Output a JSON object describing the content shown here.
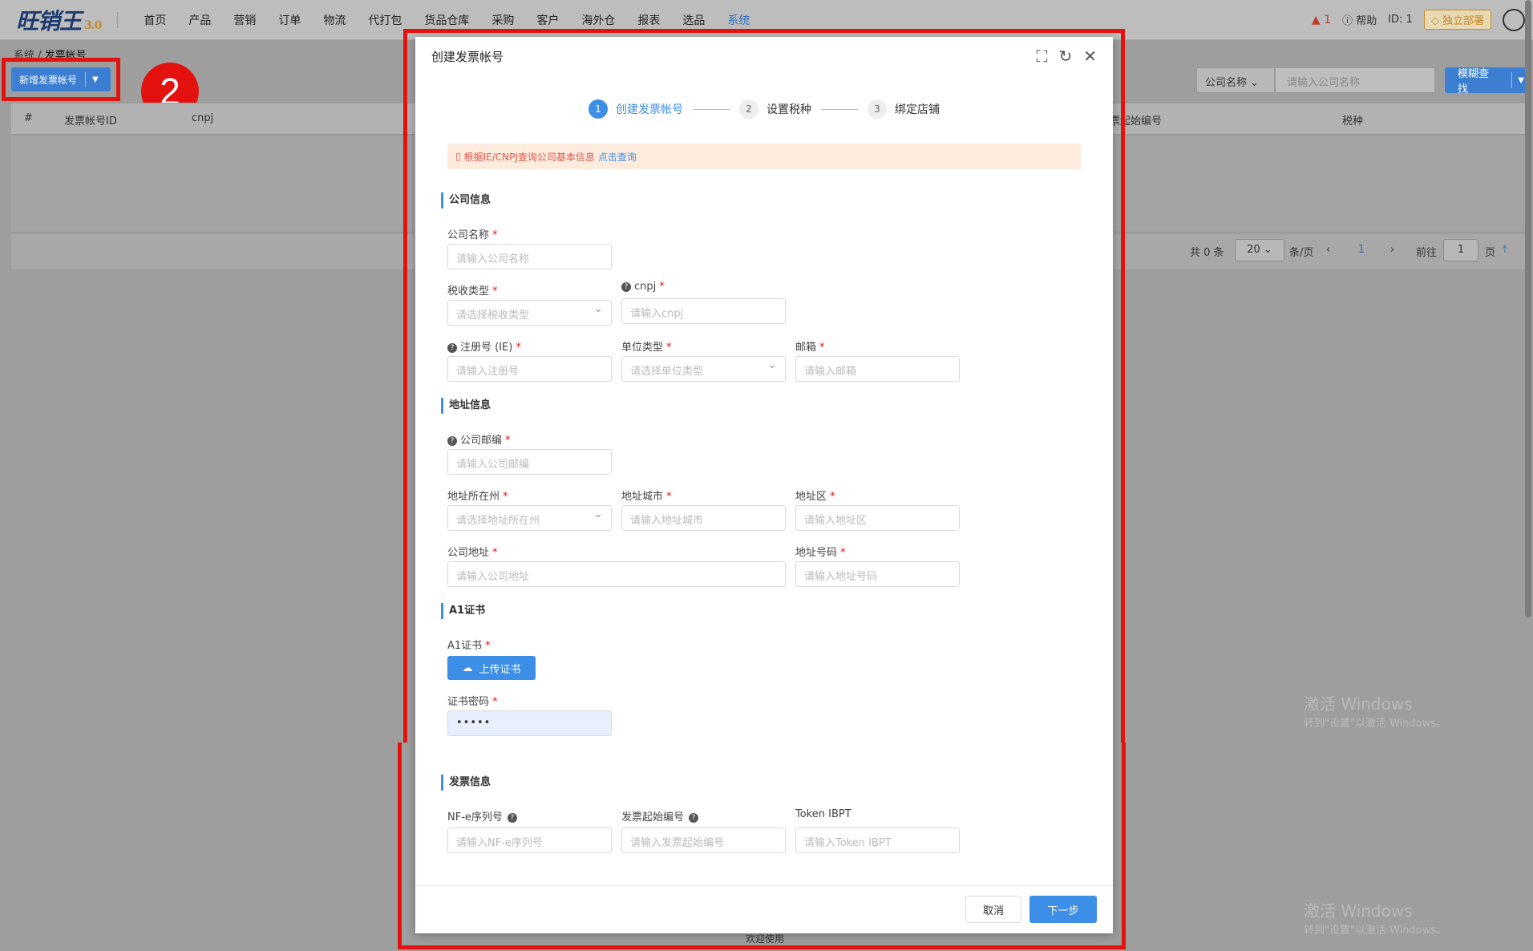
{
  "app": {
    "logo": "旺销王",
    "version": "3.0"
  },
  "nav": [
    "首页",
    "产品",
    "营销",
    "订单",
    "物流",
    "代打包",
    "货品仓库",
    "采购",
    "客户",
    "海外仓",
    "报表",
    "选品",
    "系统"
  ],
  "topright": {
    "alert_count": "1",
    "help": "帮助",
    "id": "ID: 1",
    "deploy": "独立部署"
  },
  "breadcrumb": {
    "parent": "系统",
    "current": "发票帐号"
  },
  "toolbar": {
    "add_label": "新增发票帐号"
  },
  "badge": "2",
  "search": {
    "field": "公司名称",
    "placeholder": "请输入公司名称",
    "button": "模糊查找"
  },
  "table": {
    "headers": [
      "#",
      "发票帐号ID",
      "cnpj",
      "票起始编号",
      "税种"
    ]
  },
  "pager": {
    "total": "共 0 条",
    "size": "20",
    "per": "条/页",
    "page": "1",
    "goto": "前往",
    "goto_page": "1",
    "page_unit": "页"
  },
  "watermark": {
    "title": "激活 Windows",
    "sub": "转到\"设置\"以激活 Windows。"
  },
  "footer": "欢迎使用",
  "dialog": {
    "title": "创建发票帐号",
    "steps": [
      {
        "n": "1",
        "label": "创建发票帐号"
      },
      {
        "n": "2",
        "label": "设置税种"
      },
      {
        "n": "3",
        "label": "绑定店铺"
      }
    ],
    "alert_text": "根据IE/CNPJ查询公司基本信息",
    "alert_link": "点击查询",
    "sections": {
      "company": "公司信息",
      "address": "地址信息",
      "cert": "A1证书",
      "invoice": "发票信息"
    },
    "fields": {
      "company_name": {
        "label": "公司名称",
        "placeholder": "请输入公司名称"
      },
      "tax_type": {
        "label": "税收类型",
        "placeholder": "请选择税收类型"
      },
      "cnpj": {
        "label": "cnpj",
        "placeholder": "请输入cnpj"
      },
      "reg_no": {
        "label": "注册号 (IE)",
        "placeholder": "请输入注册号"
      },
      "unit_type": {
        "label": "单位类型",
        "placeholder": "请选择单位类型"
      },
      "email": {
        "label": "邮箱",
        "placeholder": "请输入邮箱"
      },
      "postcode": {
        "label": "公司邮编",
        "placeholder": "请输入公司邮编"
      },
      "state": {
        "label": "地址所在州",
        "placeholder": "请选择地址所在州"
      },
      "city": {
        "label": "地址城市",
        "placeholder": "请输入地址城市"
      },
      "district": {
        "label": "地址区",
        "placeholder": "请输入地址区"
      },
      "address": {
        "label": "公司地址",
        "placeholder": "请输入公司地址"
      },
      "addr_no": {
        "label": "地址号码",
        "placeholder": "请输入地址号码"
      },
      "cert": {
        "label": "A1证书",
        "button": "上传证书"
      },
      "cert_pwd": {
        "label": "证书密码",
        "value": "•••••"
      },
      "nfe_serial": {
        "label": "NF-e序列号",
        "placeholder": "请输入NF-e序列号"
      },
      "invoice_start": {
        "label": "发票起始编号",
        "placeholder": "请输入发票起始编号"
      },
      "token": {
        "label": "Token IBPT",
        "placeholder": "请输入Token IBPT"
      }
    },
    "cancel": "取消",
    "next": "下一步"
  }
}
